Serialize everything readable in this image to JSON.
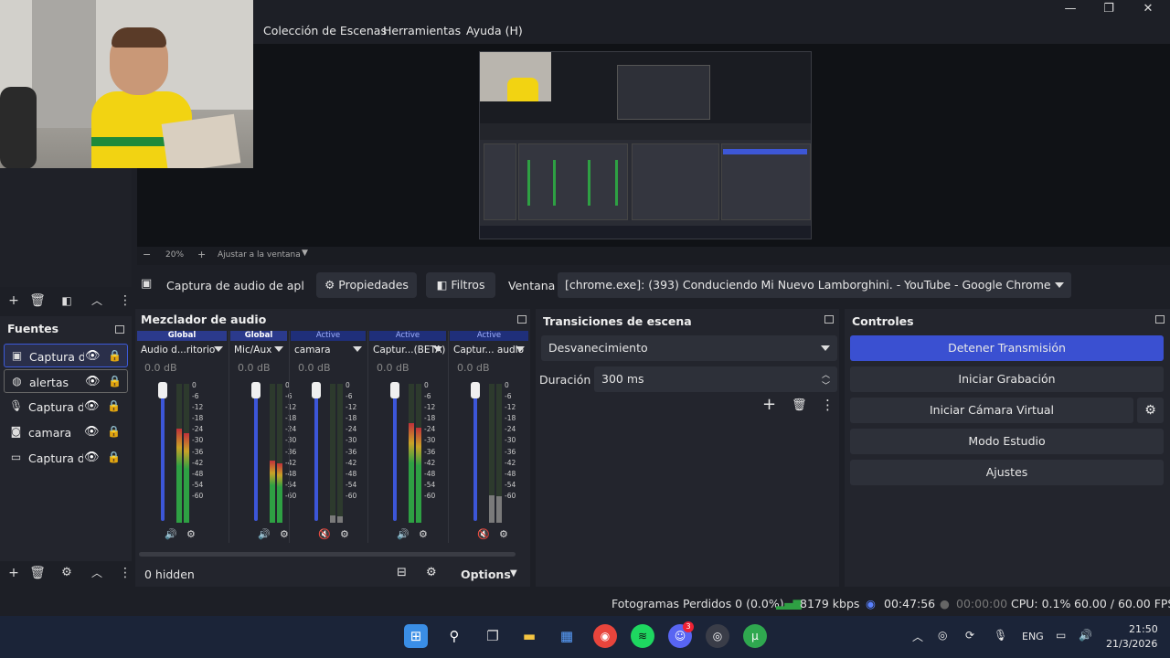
{
  "menu": {
    "items": [
      "Colección de Escenas",
      "Herramientas",
      "Ayuda (H)"
    ]
  },
  "window_controls": {
    "minimize": "—",
    "maximize": "❐",
    "close": "✕"
  },
  "zoom": {
    "minus": "−",
    "level": "20%",
    "plus": "+",
    "fit": "Ajustar a la ventana"
  },
  "source_toolbar": {
    "source_name": "Captura de audio de aplicac",
    "properties": "Propiedades",
    "filters": "Filtros",
    "window_label": "Ventana",
    "window_value": "[chrome.exe]: (393) Conduciendo Mi Nuevo Lamborghini. - YouTube - Google Chrome"
  },
  "sources": {
    "title": "Fuentes",
    "items": [
      {
        "label": "Captura d",
        "icon": "monitor-speaker-icon"
      },
      {
        "label": "alertas",
        "icon": "globe-icon"
      },
      {
        "label": "Captura d",
        "icon": "microphone-icon"
      },
      {
        "label": "camara",
        "icon": "camera-icon"
      },
      {
        "label": "Captura d",
        "icon": "display-icon"
      }
    ]
  },
  "mixer": {
    "title": "Mezclador de audio",
    "scale": [
      "0",
      "-6",
      "-12",
      "-18",
      "-24",
      "-30",
      "-36",
      "-42",
      "-48",
      "-54",
      "-60"
    ],
    "channels": [
      {
        "header": "Global",
        "name": "Audio d...ritorio",
        "db": "0.0 dB",
        "muted": false,
        "level": 0.68
      },
      {
        "header": "Global",
        "name": "Mic/Aux",
        "db": "0.0 dB",
        "muted": false,
        "level": 0.45
      },
      {
        "header": "Active",
        "name": "camara",
        "db": "0.0 dB",
        "muted": true,
        "level": 0.05
      },
      {
        "header": "Active",
        "name": "Captur...(BETA)",
        "db": "0.0 dB",
        "muted": false,
        "level": 0.72
      },
      {
        "header": "Active",
        "name": "Captur... audio",
        "db": "0.0 dB",
        "muted": true,
        "level": 0.2
      }
    ],
    "footer": {
      "hidden": "0 hidden",
      "options": "Options"
    }
  },
  "transitions": {
    "title": "Transiciones de escena",
    "selected": "Desvanecimiento",
    "duration_label": "Duración",
    "duration_value": "300 ms"
  },
  "controls": {
    "title": "Controles",
    "stop_stream": "Detener Transmisión",
    "start_recording": "Iniciar Grabación",
    "virtual_camera": "Iniciar Cámara Virtual",
    "studio_mode": "Modo Estudio",
    "settings": "Ajustes"
  },
  "status": {
    "dropped_frames": "Fotogramas Perdidos 0 (0.0%)",
    "bitrate": "8179 kbps",
    "stream_time": "00:47:56",
    "record_time": "00:00:00",
    "cpu": "CPU: 0.1%",
    "fps": "60.00 / 60.00 FPS"
  },
  "taskbar": {
    "lang": "ENG",
    "time": "21:50",
    "date": "21/3/2026",
    "discord_badge": "3"
  },
  "colors": {
    "accent": "#3a50d1",
    "panel": "#23252d",
    "background": "#1d1f26",
    "meter_green": "#2ea043",
    "meter_yellow": "#c9a227",
    "meter_red": "#c0303a",
    "muted_red": "#d23a3a"
  }
}
